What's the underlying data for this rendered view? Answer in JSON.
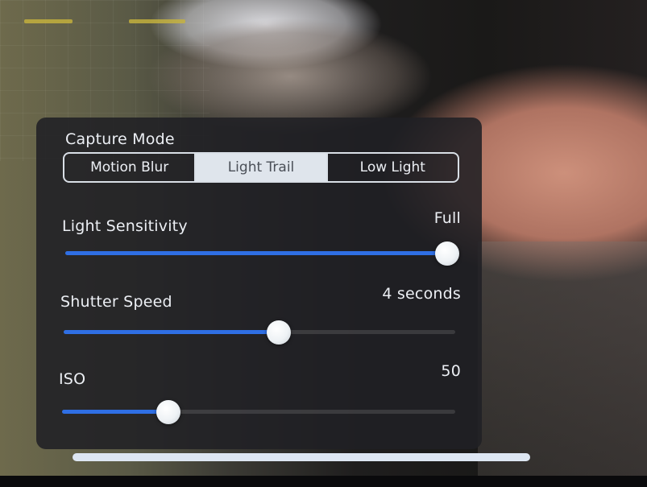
{
  "capture_mode": {
    "title": "Capture Mode",
    "options": [
      "Motion Blur",
      "Light Trail",
      "Low Light"
    ],
    "selected": "Light Trail"
  },
  "light_sensitivity": {
    "label": "Light Sensitivity",
    "value_text": "Full",
    "level": 1.0
  },
  "shutter_speed": {
    "label": "Shutter Speed",
    "value_text": "4 seconds",
    "level": 0.55
  },
  "iso": {
    "label": "ISO",
    "value_text": "50",
    "level": 0.27
  },
  "colors": {
    "accent": "#2f6fe4",
    "panel": "#202024",
    "segment_selected": "#dfe5ec"
  }
}
